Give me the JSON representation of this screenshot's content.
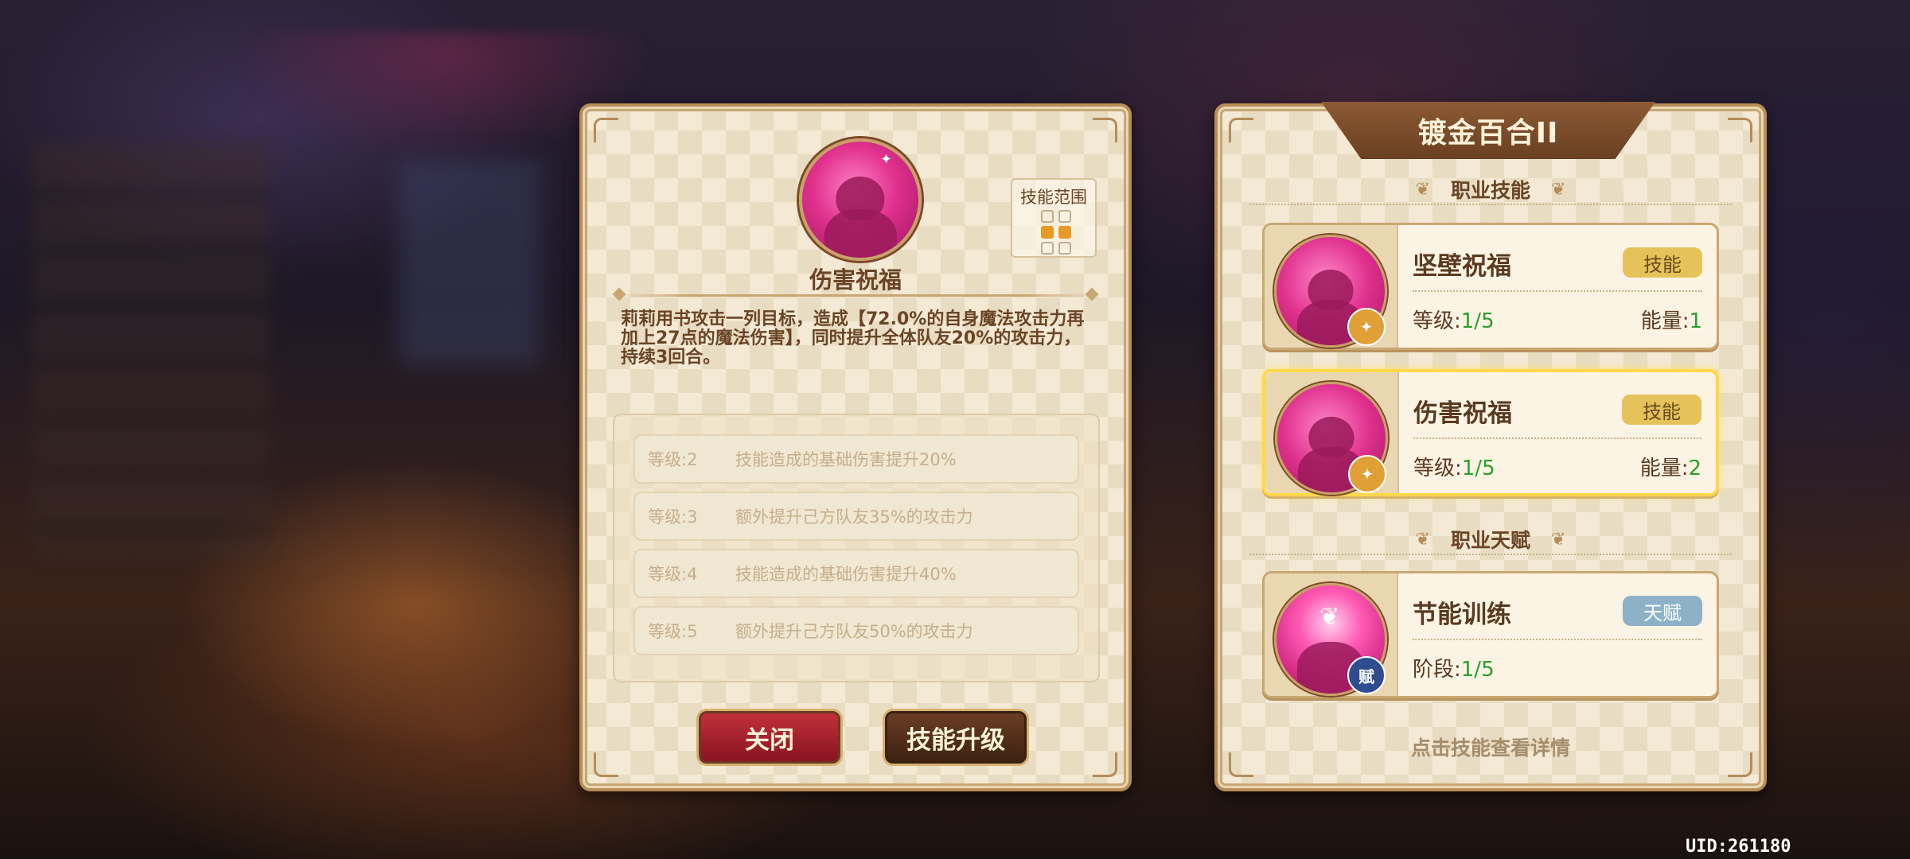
{
  "skill_detail": {
    "name": "伤害祝福",
    "range_label": "技能范围",
    "range_grid": [
      false,
      false,
      true,
      true,
      false,
      false
    ],
    "description": "莉莉用书攻击一列目标，造成【72.0%的自身魔法攻击力再加上27点的魔法伤害】，同时提升全体队友20%的攻击力，持续3回合。",
    "upgrades": [
      {
        "level": "等级:2",
        "effect": "技能造成的基础伤害提升20%"
      },
      {
        "level": "等级:3",
        "effect": "额外提升己方队友35%的攻击力"
      },
      {
        "level": "等级:4",
        "effect": "技能造成的基础伤害提升40%"
      },
      {
        "level": "等级:5",
        "effect": "额外提升己方队友50%的攻击力"
      }
    ],
    "close_label": "关闭",
    "upgrade_label": "技能升级"
  },
  "class_panel": {
    "title": "镀金百合II",
    "skills_header": "职业技能",
    "talent_header": "职业天赋",
    "hint": "点击技能查看详情",
    "cards": [
      {
        "name": "坚壁祝福",
        "tag": "技能",
        "level_label": "等级:",
        "level_value": "1/5",
        "energy_label": "能量:",
        "energy_value": "1",
        "badge": "✦"
      },
      {
        "name": "伤害祝福",
        "tag": "技能",
        "level_label": "等级:",
        "level_value": "1/5",
        "energy_label": "能量:",
        "energy_value": "2",
        "badge": "✦"
      },
      {
        "name": "节能训练",
        "tag": "天赋",
        "stage_label": "阶段:",
        "stage_value": "1/5",
        "badge": "赋"
      }
    ]
  },
  "uid": "UID:261180",
  "colors": {
    "panel": "#f3e9d4",
    "accent_brown": "#6a4426",
    "close_red": "#a01c2a",
    "value_green": "#2aa02a",
    "selected_gold": "#ffd84a"
  }
}
